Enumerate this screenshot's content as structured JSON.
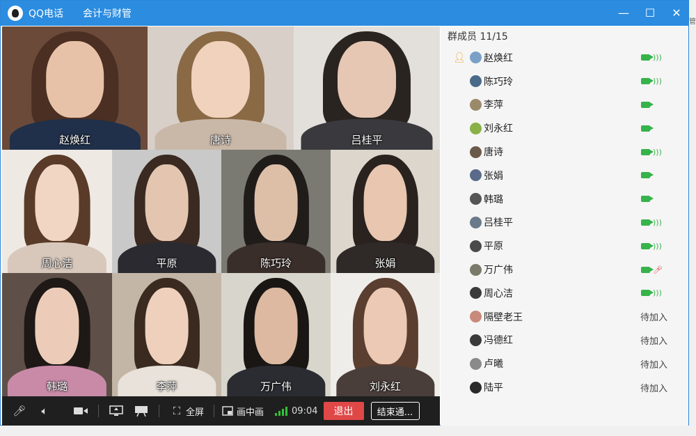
{
  "window": {
    "app_title": "QQ电话",
    "group_name": "会计与财管",
    "minimize": "—",
    "maximize": "☐",
    "close": "✕"
  },
  "edge_text": "管",
  "tiles": [
    {
      "name": "赵焕红",
      "bg": "#6b4a3a",
      "hair": "#4a2f22",
      "face": "#e8c2a8",
      "body": "#20304a"
    },
    {
      "name": "唐诗",
      "bg": "#d8cfc8",
      "hair": "#8a6a45",
      "face": "#f0d2bd",
      "body": "#c9b8a8"
    },
    {
      "name": "吕桂平",
      "bg": "#e3e0dc",
      "hair": "#2a2420",
      "face": "#e6c7b4",
      "body": "#3a3a3e"
    },
    {
      "name": "周心洁",
      "bg": "#efe9e4",
      "hair": "#5a3a28",
      "face": "#f2d6c4",
      "body": "#d8c8bc"
    },
    {
      "name": "平原",
      "bg": "#c9c9c9",
      "hair": "#3a2a22",
      "face": "#e4c6b0",
      "body": "#2a2a30"
    },
    {
      "name": "陈巧玲",
      "bg": "#7a7a72",
      "hair": "#201c1a",
      "face": "#ddbfa8",
      "body": "#3a2e2a"
    },
    {
      "name": "张娟",
      "bg": "#dcd6cc",
      "hair": "#2a221e",
      "face": "#e8c6b0",
      "body": "#2f2a28"
    },
    {
      "name": "韩璐",
      "bg": "#5e5048",
      "hair": "#1e1816",
      "face": "#ecccb8",
      "body": "#c98aa8"
    },
    {
      "name": "李萍",
      "bg": "#c4b6a6",
      "hair": "#3a2a20",
      "face": "#efd0bc",
      "body": "#e8e2da"
    },
    {
      "name": "万广伟",
      "bg": "#d8d6cc",
      "hair": "#1a1614",
      "face": "#dcb9a0",
      "body": "#2a2c32"
    },
    {
      "name": "刘永红",
      "bg": "#efedea",
      "hair": "#5a3e30",
      "face": "#ebc9b4",
      "body": "#4a3e3a"
    }
  ],
  "toolbar": {
    "mic_icon": "microphone-icon",
    "speaker_icon": "speaker-icon",
    "camera_icon": "camera-icon",
    "share_icon": "screen-share-icon",
    "whiteboard_icon": "whiteboard-icon",
    "fullscreen_label": "全屏",
    "pip_label": "画中画",
    "time": "09:04",
    "exit_label": "退出",
    "end_label": "结束通..."
  },
  "member_header": "群成员 11/15",
  "members": [
    {
      "name": "赵焕红",
      "host": true,
      "status": "video-audio",
      "avatar": "#7aa0c8"
    },
    {
      "name": "陈巧玲",
      "host": false,
      "status": "video-audio",
      "avatar": "#4a6a8a"
    },
    {
      "name": "李萍",
      "host": false,
      "status": "video",
      "avatar": "#9a8a6a"
    },
    {
      "name": "刘永红",
      "host": false,
      "status": "video",
      "avatar": "#8ab048"
    },
    {
      "name": "唐诗",
      "host": false,
      "status": "video-audio",
      "avatar": "#6a5a4a"
    },
    {
      "name": "张娟",
      "host": false,
      "status": "video",
      "avatar": "#5a6a8a"
    },
    {
      "name": "韩璐",
      "host": false,
      "status": "video",
      "avatar": "#555555"
    },
    {
      "name": "吕桂平",
      "host": false,
      "status": "video-audio",
      "avatar": "#6a7a8a"
    },
    {
      "name": "平原",
      "host": false,
      "status": "video-audio",
      "avatar": "#4a4a4a"
    },
    {
      "name": "万广伟",
      "host": false,
      "status": "video-muted",
      "avatar": "#7a7a6a"
    },
    {
      "name": "周心洁",
      "host": false,
      "status": "video-audio",
      "avatar": "#3a3a3a"
    },
    {
      "name": "隔壁老王",
      "host": false,
      "status": "pending",
      "avatar": "#c88a7a"
    },
    {
      "name": "冯德红",
      "host": false,
      "status": "pending",
      "avatar": "#3a3a3a"
    },
    {
      "name": "卢曦",
      "host": false,
      "status": "pending",
      "avatar": "#8a8a8a"
    },
    {
      "name": "陆平",
      "host": false,
      "status": "pending",
      "avatar": "#2a2a2a"
    }
  ],
  "pending_label": "待加入",
  "colors": {
    "title_bar": "#2b8ce0",
    "exit": "#e04848",
    "active": "#36b34a",
    "muted": "#e05050"
  }
}
